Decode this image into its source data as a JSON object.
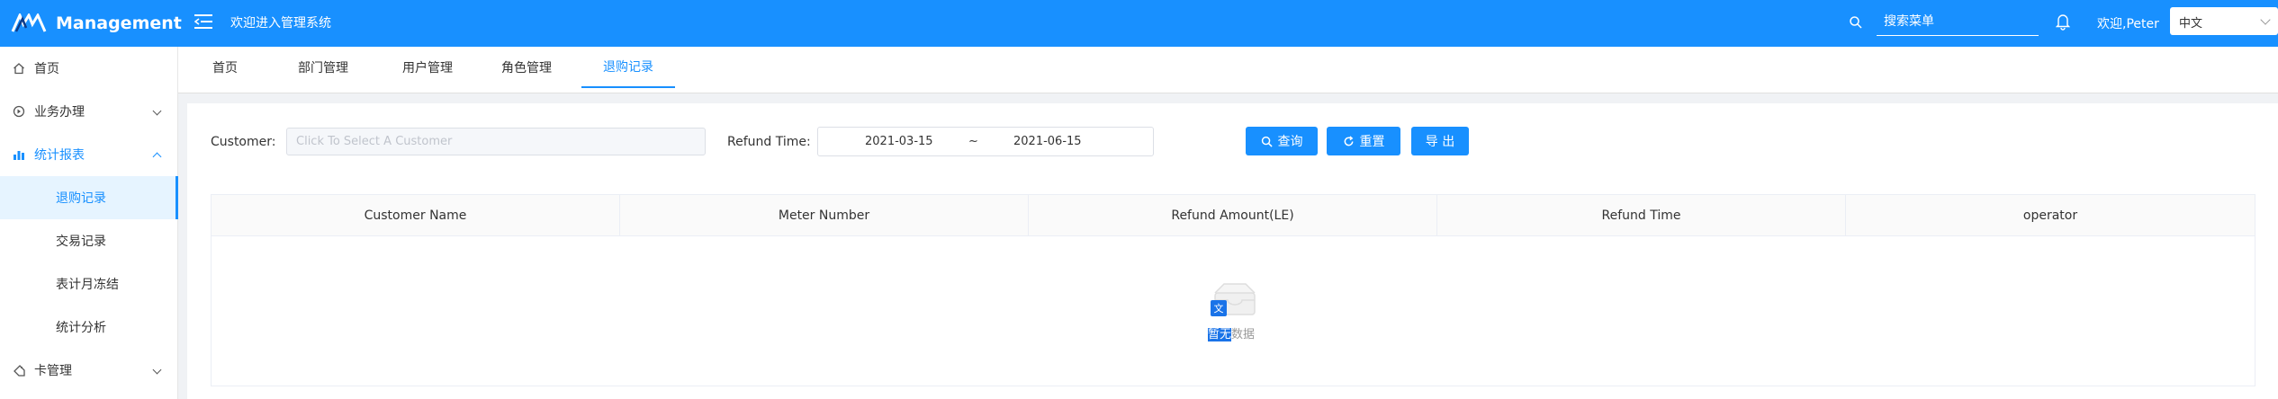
{
  "header": {
    "app_title": "Management",
    "welcome": "欢迎进入管理系统",
    "search_placeholder": "搜索菜单",
    "user": "欢迎,Peter",
    "language": "中文"
  },
  "sidebar": {
    "home": "首页",
    "business": "业务办理",
    "stats": "统计报表",
    "sub_items": [
      "退购记录",
      "交易记录",
      "表计月冻结",
      "统计分析"
    ],
    "card": "卡管理"
  },
  "tabs": [
    "首页",
    "部门管理",
    "用户管理",
    "角色管理",
    "退购记录"
  ],
  "filter": {
    "customer_label": "Customer",
    "customer_placeholder": "Click To Select A Customer",
    "refund_label": "Refund Time",
    "date_start": "2021-03-15",
    "date_sep": "~",
    "date_end": "2021-06-15",
    "query": "查询",
    "reset": "重置",
    "export": "导 出"
  },
  "table": {
    "columns": [
      "Customer Name",
      "Meter Number",
      "Refund Amount(LE)",
      "Refund Time",
      "operator"
    ],
    "empty_selected": "暂无",
    "empty_rest": "数据"
  },
  "colors": {
    "primary": "#1890ff",
    "active_bg": "#e6f4ff"
  }
}
